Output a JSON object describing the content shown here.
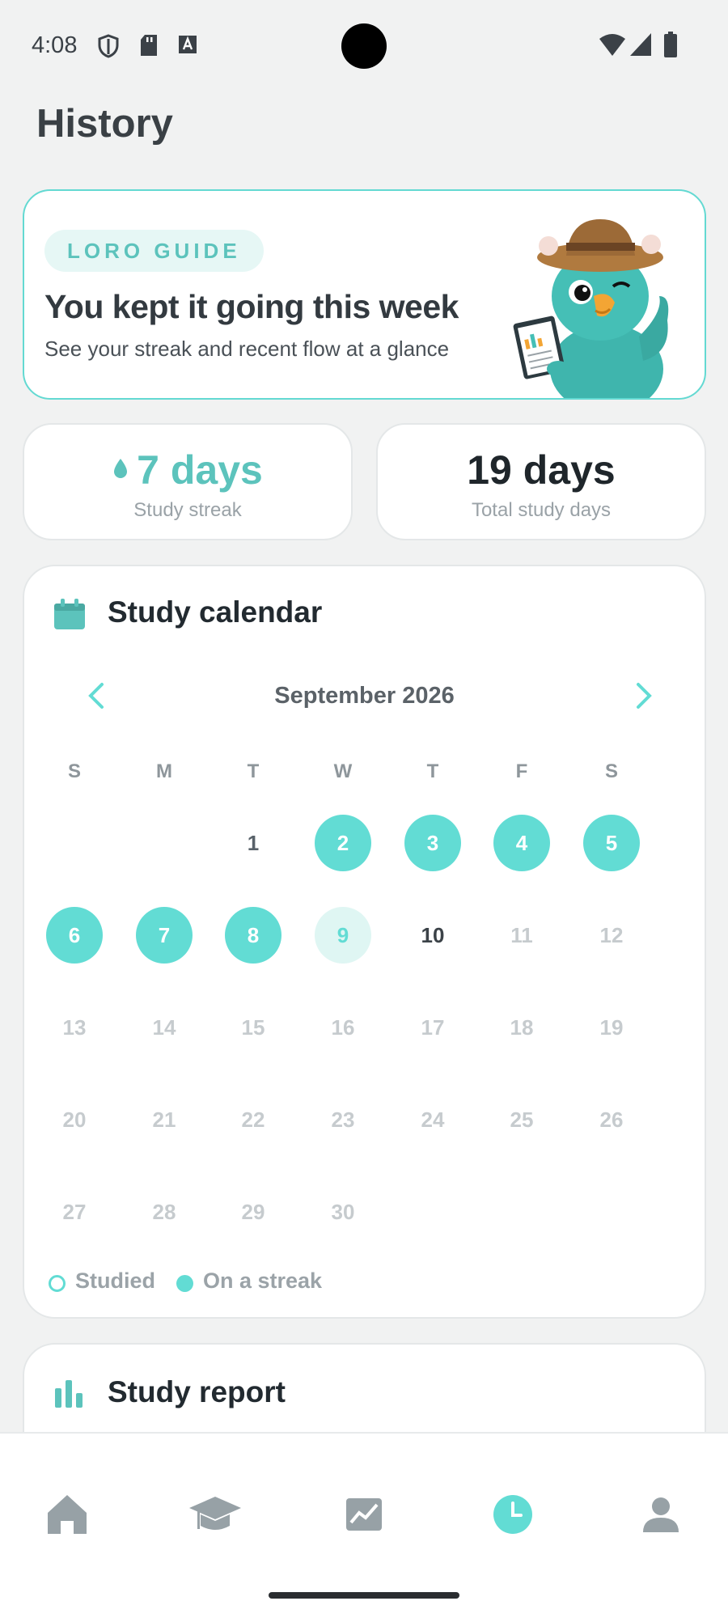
{
  "status_bar": {
    "time": "4:08",
    "icons": [
      "shield-icon",
      "sd-card-icon",
      "font-icon",
      "wifi-icon",
      "signal-icon",
      "battery-icon"
    ]
  },
  "page": {
    "title": "History"
  },
  "guide": {
    "badge": "LORO GUIDE",
    "title": "You kept it going this week",
    "subtitle": "See your streak and recent flow at a glance",
    "image": "parrot-mascot-illustration"
  },
  "stats": {
    "streak": {
      "value": "7 days",
      "label": "Study streak",
      "icon": "water-drop-icon"
    },
    "total": {
      "value": "19 days",
      "label": "Total study days"
    }
  },
  "calendar": {
    "title": "Study calendar",
    "icon": "calendar-icon",
    "month": "September 2026",
    "weekdays": [
      "S",
      "M",
      "T",
      "W",
      "T",
      "F",
      "S"
    ],
    "first_weekday_index": 2,
    "days": [
      {
        "n": "1",
        "state": "past"
      },
      {
        "n": "2",
        "state": "streak"
      },
      {
        "n": "3",
        "state": "streak"
      },
      {
        "n": "4",
        "state": "streak"
      },
      {
        "n": "5",
        "state": "streak"
      },
      {
        "n": "6",
        "state": "streak"
      },
      {
        "n": "7",
        "state": "streak"
      },
      {
        "n": "8",
        "state": "streak"
      },
      {
        "n": "9",
        "state": "studied"
      },
      {
        "n": "10",
        "state": "today"
      },
      {
        "n": "11",
        "state": "future"
      },
      {
        "n": "12",
        "state": "future"
      },
      {
        "n": "13",
        "state": "future"
      },
      {
        "n": "14",
        "state": "future"
      },
      {
        "n": "15",
        "state": "future"
      },
      {
        "n": "16",
        "state": "future"
      },
      {
        "n": "17",
        "state": "future"
      },
      {
        "n": "18",
        "state": "future"
      },
      {
        "n": "19",
        "state": "future"
      },
      {
        "n": "20",
        "state": "future"
      },
      {
        "n": "21",
        "state": "future"
      },
      {
        "n": "22",
        "state": "future"
      },
      {
        "n": "23",
        "state": "future"
      },
      {
        "n": "24",
        "state": "future"
      },
      {
        "n": "25",
        "state": "future"
      },
      {
        "n": "26",
        "state": "future"
      },
      {
        "n": "27",
        "state": "future"
      },
      {
        "n": "28",
        "state": "future"
      },
      {
        "n": "29",
        "state": "future"
      },
      {
        "n": "30",
        "state": "future"
      }
    ],
    "legend": {
      "studied": "Studied",
      "streak": "On a streak"
    }
  },
  "report": {
    "title": "Study report",
    "icon": "bar-chart-icon"
  },
  "nav": {
    "items": [
      {
        "name": "home",
        "icon": "home-icon",
        "active": false
      },
      {
        "name": "learn",
        "icon": "graduation-cap-icon",
        "active": false
      },
      {
        "name": "progress",
        "icon": "trending-chart-icon",
        "active": false
      },
      {
        "name": "history",
        "icon": "clock-icon",
        "active": true
      },
      {
        "name": "profile",
        "icon": "person-icon",
        "active": false
      }
    ]
  },
  "colors": {
    "accent": "#62dcd4",
    "accent_light": "#dff6f3",
    "background": "#f1f2f2"
  }
}
